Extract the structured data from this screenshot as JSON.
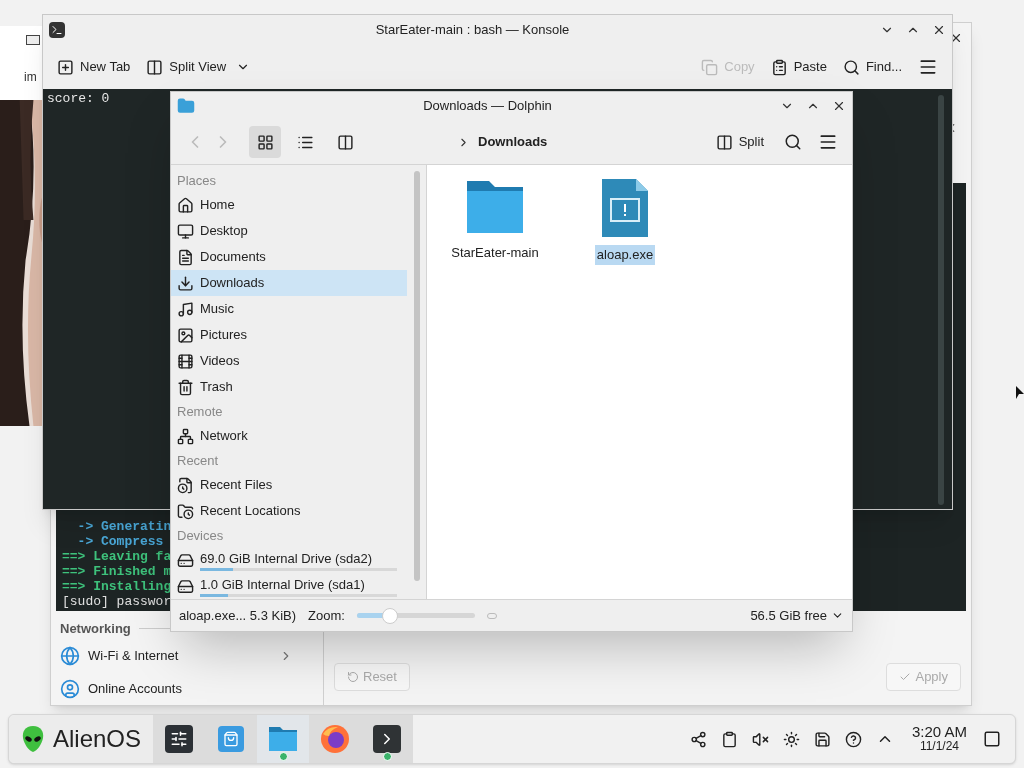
{
  "background_window": {
    "text": "im"
  },
  "settings_window": {
    "terminal_lines": [
      "  -> Generatin",
      "  -> Compress",
      "==> Leaving fa",
      "==> Finished m",
      "==> Installing",
      "[sudo] passwor"
    ],
    "section": "Networking",
    "items": [
      {
        "label": "Wi-Fi & Internet",
        "has_submenu": true
      },
      {
        "label": "Online Accounts",
        "has_submenu": false
      }
    ],
    "buttons": [
      {
        "label": "Reset",
        "disabled": true
      },
      {
        "label": "Apply",
        "disabled": true
      }
    ]
  },
  "konsole": {
    "title": "StarEater-main : bash — Konsole",
    "toolbar": [
      {
        "label": "New Tab",
        "disabled": false
      },
      {
        "label": "Split View",
        "disabled": false
      },
      {
        "label": "Copy",
        "disabled": true
      },
      {
        "label": "Paste",
        "disabled": false
      },
      {
        "label": "Find...",
        "disabled": false
      }
    ],
    "output": "score: 0"
  },
  "dolphin": {
    "title": "Downloads — Dolphin",
    "view_modes": [
      {
        "selected": true
      },
      {
        "selected": false
      },
      {
        "selected": false
      }
    ],
    "breadcrumb": "Downloads",
    "split_label": "Split",
    "sidebar": [
      {
        "title": "Places",
        "items": [
          {
            "label": "Home",
            "selected": false
          },
          {
            "label": "Desktop",
            "selected": false
          },
          {
            "label": "Documents",
            "selected": false
          },
          {
            "label": "Downloads",
            "selected": true
          },
          {
            "label": "Music",
            "selected": false
          },
          {
            "label": "Pictures",
            "selected": false
          },
          {
            "label": "Videos",
            "selected": false
          },
          {
            "label": "Trash",
            "selected": false
          }
        ]
      },
      {
        "title": "Remote",
        "items": [
          {
            "label": "Network",
            "selected": false
          }
        ]
      },
      {
        "title": "Recent",
        "items": [
          {
            "label": "Recent Files",
            "selected": false
          },
          {
            "label": "Recent Locations",
            "selected": false
          }
        ]
      },
      {
        "title": "Devices",
        "items": [
          {
            "label": "69.0 GiB Internal Drive (sda2)",
            "selected": false,
            "level": 0.17
          },
          {
            "label": "1.0 GiB Internal Drive (sda1)",
            "selected": false,
            "level": 0.14
          }
        ]
      }
    ],
    "files": [
      {
        "name": "StarEater-main",
        "kind": "folder",
        "selected": false
      },
      {
        "name": "aloap.exe",
        "kind": "executable",
        "selected": true
      }
    ],
    "status": {
      "selection": "aloap.exe... 5.3 KiB)",
      "zoom_label": "Zoom:",
      "zoom": {
        "level": 0.28
      },
      "free_space": "56.5 GiB free"
    }
  },
  "taskbar": {
    "launcher": "AlienOS",
    "tasks": [
      {
        "selected": false,
        "badge": false
      },
      {
        "selected": false,
        "badge": false
      },
      {
        "selected": true,
        "badge": true
      },
      {
        "selected": false,
        "badge": false
      },
      {
        "selected": false,
        "badge": true
      }
    ],
    "clock": {
      "time": "3:20 AM",
      "date": "11/1/24"
    }
  }
}
